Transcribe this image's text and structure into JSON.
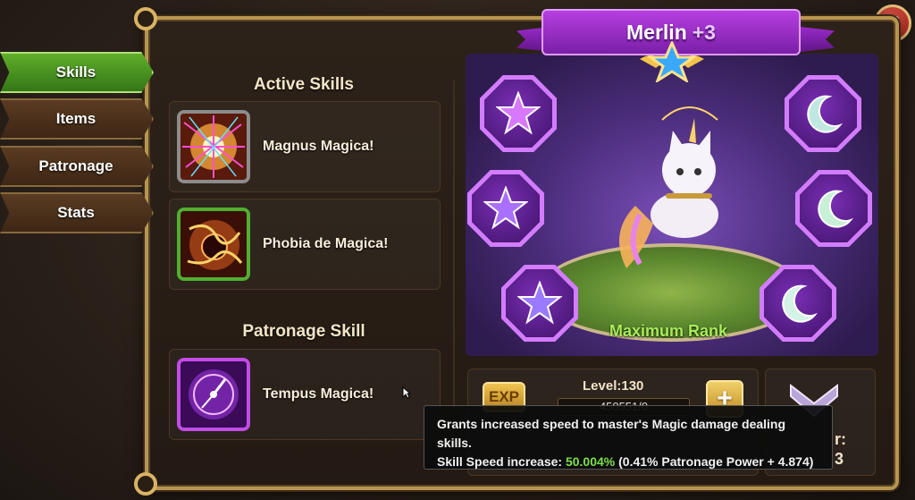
{
  "tabs": [
    {
      "label": "Skills",
      "active": true
    },
    {
      "label": "Items"
    },
    {
      "label": "Patronage"
    },
    {
      "label": "Stats"
    }
  ],
  "skills": {
    "active_title": "Active Skills",
    "active": [
      {
        "name": "Magnus Magica!",
        "icon": "magnus-magica-icon"
      },
      {
        "name": "Phobia de Magica!",
        "icon": "phobia-de-magica-icon"
      }
    ],
    "patronage_title": "Patronage Skill",
    "patronage": {
      "name": "Tempus Magica!",
      "icon": "tempus-magica-icon"
    }
  },
  "pet": {
    "name": "Merlin",
    "rank_plus": "+3",
    "rank_status": "Maximum Rank",
    "left_items": [
      "star-gem-icon",
      "star-gem-icon",
      "star-gem-icon"
    ],
    "right_items": [
      "moon-gem-icon",
      "moon-gem-icon",
      "moon-gem-icon"
    ]
  },
  "exp": {
    "badge": "EXP",
    "level_label": "Level:130",
    "progress_text": "450551/0",
    "add_label": "+"
  },
  "power": {
    "fragment": "r:\n3"
  },
  "tooltip": {
    "line1": "Grants increased speed to master's Magic damage dealing skills.",
    "stat_label": "Skill Speed increase:",
    "stat_value": "50.004%",
    "stat_detail": "(0.41% Patronage Power + 4.874)"
  },
  "close": "✕",
  "colors": {
    "tab_active": "#4f9e23",
    "rank_text": "#a9ec5b",
    "tooltip_value": "#7be04a",
    "banner": "#a632d6"
  }
}
